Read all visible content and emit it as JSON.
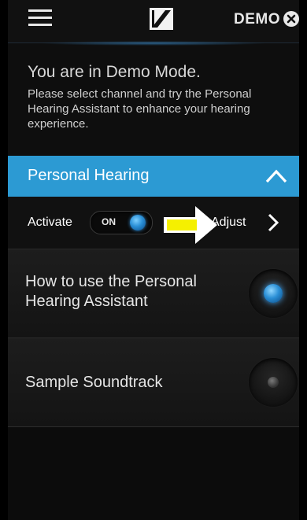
{
  "header": {
    "demo_label": "DEMO",
    "menu_icon": "hamburger-menu-icon",
    "logo_icon": "sennheiser-logo-icon",
    "close_icon": "close-circle-icon"
  },
  "demo_info": {
    "title": "You are in Demo Mode.",
    "description": "Please select channel and try the Personal Hearing Assistant to enhance your hearing experience."
  },
  "personal_hearing": {
    "title": "Personal Hearing",
    "collapse_icon": "chevron-up-icon",
    "accent_color": "#2c9ad3"
  },
  "activate_row": {
    "label": "Activate",
    "toggle_text": "ON",
    "toggle_on": true,
    "adjust_label": "Adjust",
    "adjust_icon": "chevron-right-icon",
    "annotation_arrow_color": "#f5f000"
  },
  "list": [
    {
      "label": "How to use the Personal Hearing Assistant",
      "active": true
    },
    {
      "label": "Sample Soundtrack",
      "active": false
    }
  ]
}
